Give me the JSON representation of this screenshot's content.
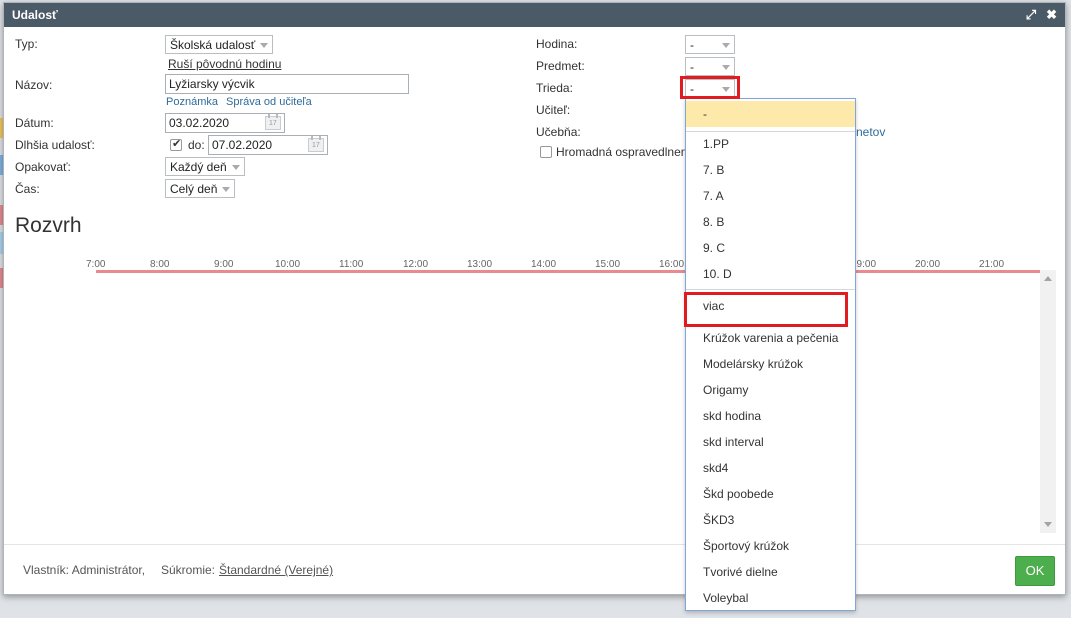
{
  "dialog": {
    "title": "Udalosť"
  },
  "form_left": {
    "typ": {
      "label": "Typ:",
      "value": "Školská udalosť",
      "sublink": "Ruší pôvodnú hodinu"
    },
    "nazov": {
      "label": "Názov:",
      "value": "Lyžiarsky výcvik",
      "link_note": "Poznámka",
      "link_msg": "Správa od učiteľa"
    },
    "datum": {
      "label": "Dátum:",
      "value": "03.02.2020"
    },
    "dlhsia": {
      "label": "Dlhšia udalosť:",
      "checked": true,
      "do_label": "do:",
      "value": "07.02.2020"
    },
    "opakovat": {
      "label": "Opakovať:",
      "value": "Každý deň"
    },
    "cas": {
      "label": "Čas:",
      "value": "Celý deň"
    }
  },
  "form_right": {
    "hodina": {
      "label": "Hodina:",
      "value": "-"
    },
    "predmet": {
      "label": "Predmet:",
      "value": "-"
    },
    "trieda": {
      "label": "Trieda:",
      "value": "-"
    },
    "ucitel": {
      "label": "Učiteľ:"
    },
    "ucebna": {
      "label": "Učebňa:",
      "partial_link": "netov"
    },
    "hromadna": {
      "label": "Hromadná ospravedlnen",
      "checked": false
    }
  },
  "schedule": {
    "heading": "Rozvrh",
    "hours": [
      "7:00",
      "8:00",
      "9:00",
      "10:00",
      "11:00",
      "12:00",
      "13:00",
      "14:00",
      "15:00",
      "16:00",
      "19:00",
      "20:00",
      "21:00"
    ]
  },
  "footer": {
    "owner": "Vlastník: Administrátor,",
    "privacy_label": "Súkromie:",
    "privacy_value": "Štandardné (Verejné)",
    "ok": "OK"
  },
  "dropdown": {
    "selected": "-",
    "group1": [
      "1.PP",
      "7. B",
      "7. A",
      "8. B",
      "9. C",
      "10. D"
    ],
    "group2": [
      "viac",
      "Krúžok varenia a pečenia",
      "Modelársky krúžok",
      "Origamy",
      "skd hodina",
      "skd interval",
      "skd4",
      "Škd poobede",
      "ŠKD3",
      "Športový krúžok",
      "Tvorivé dielne",
      "Voleybal"
    ]
  },
  "colors": {
    "titlebar": "#4a5a66",
    "timeline": "#e88a8f",
    "highlight": "#fde9a9",
    "annotation": "#e01b22",
    "ok_button": "#4cae4c"
  }
}
